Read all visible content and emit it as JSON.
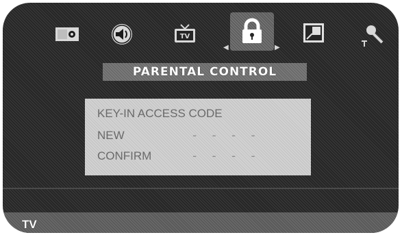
{
  "menu": {
    "icons": [
      {
        "name": "picture-icon",
        "selected": false
      },
      {
        "name": "sound-icon",
        "selected": false
      },
      {
        "name": "tv-icon",
        "selected": false,
        "badge": "TV"
      },
      {
        "name": "lock-icon",
        "selected": true
      },
      {
        "name": "screen-setup-icon",
        "selected": false
      },
      {
        "name": "setup-icon",
        "selected": false
      }
    ]
  },
  "title": "PARENTAL CONTROL",
  "dialog": {
    "heading": "KEY-IN ACCESS CODE",
    "new_label": "NEW",
    "new_value": "- - - -",
    "confirm_label": "CONFIRM",
    "confirm_value": "- - - -"
  },
  "footer": {
    "source": "TV"
  },
  "colors": {
    "panel": "#262626",
    "dialog": "#d2d2d2",
    "title_bar": "#6a6a6a"
  }
}
